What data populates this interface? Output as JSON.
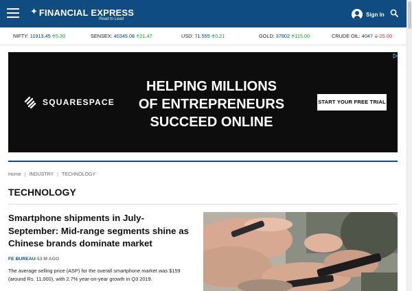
{
  "header": {
    "brand": "FINANCIAL EXPRESS",
    "tagline": "Read to Lead",
    "signin_label": "Sign In",
    "bg_color": "#0f4c81"
  },
  "icons": {
    "menu": "hamburger-menu-icon",
    "brand": "star-logo-icon",
    "user": "user-avatar-icon",
    "search": "search-icon",
    "ad_choices": "ad-choices-icon",
    "squarespace": "squarespace-logo-icon"
  },
  "ticker": [
    {
      "label": "NIFTY:",
      "value": "11913.45",
      "change": "5.30",
      "direction": "up"
    },
    {
      "label": "SENSEX:",
      "value": "40345.08",
      "change": "21.47",
      "direction": "up"
    },
    {
      "label": "USD:",
      "value": "71.555",
      "change": "0.21",
      "direction": "up"
    },
    {
      "label": "GOLD:",
      "value": "37802",
      "change": "115.00",
      "direction": "up"
    },
    {
      "label": "CRUDE OIL:",
      "value": "4047",
      "change": "-25.00",
      "direction": "down"
    }
  ],
  "ad": {
    "brand": "SQUARESPACE",
    "headline": [
      "HELPING MILLIONS",
      "OF ENTREPRENEURS",
      "SUCCEED ONLINE"
    ],
    "cta": "START YOUR FREE TRIAL"
  },
  "breadcrumb": [
    "Home",
    "INDUSTRY",
    "TECHNOLOGY"
  ],
  "page_title": "TECHNOLOGY",
  "lead_story": {
    "headline": "Smartphone shipments in July-September: Mid-range segments shine as Chinese brands dominate market",
    "author": "FE BUREAU",
    "time": "-53 M AGO",
    "summary": "The average selling price (ASP) for the overall smartphone market was $159 (around Rs. 11,000), with 2.7% year-on-year growth in Q3 2019."
  },
  "colors": {
    "brand_blue": "#0f4c81",
    "up": "#1a9b35",
    "down": "#d3272b"
  }
}
